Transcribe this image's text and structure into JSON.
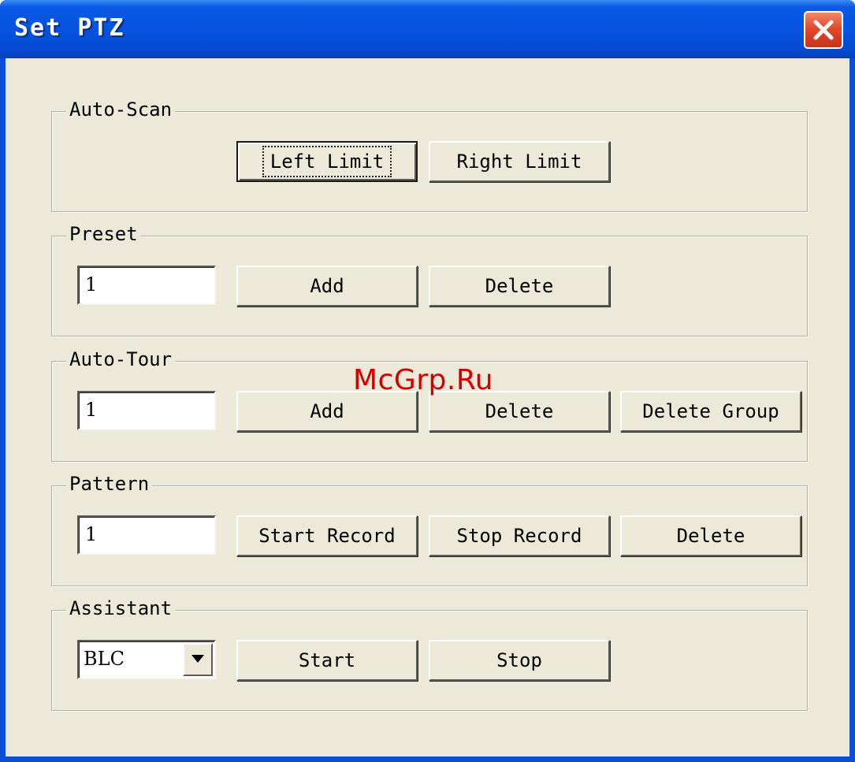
{
  "window": {
    "title": "Set PTZ"
  },
  "groups": {
    "auto_scan": {
      "label": "Auto-Scan",
      "left_limit": "Left Limit",
      "right_limit": "Right Limit"
    },
    "preset": {
      "label": "Preset",
      "value": "1",
      "add": "Add",
      "delete": "Delete"
    },
    "auto_tour": {
      "label": "Auto-Tour",
      "value": "1",
      "add": "Add",
      "delete": "Delete",
      "delete_group": "Delete Group"
    },
    "pattern": {
      "label": "Pattern",
      "value": "1",
      "start_record": "Start Record",
      "stop_record": "Stop Record",
      "delete": "Delete"
    },
    "assistant": {
      "label": "Assistant",
      "selected": "BLC",
      "start": "Start",
      "stop": "Stop"
    }
  },
  "watermark": "McGrp.Ru",
  "colors": {
    "titlebar": "#0553e0",
    "face": "#ece9d8",
    "close": "#e2492c",
    "watermark": "#d40000"
  },
  "icons": {
    "close": "close-icon",
    "dropdown": "chevron-down-icon"
  }
}
